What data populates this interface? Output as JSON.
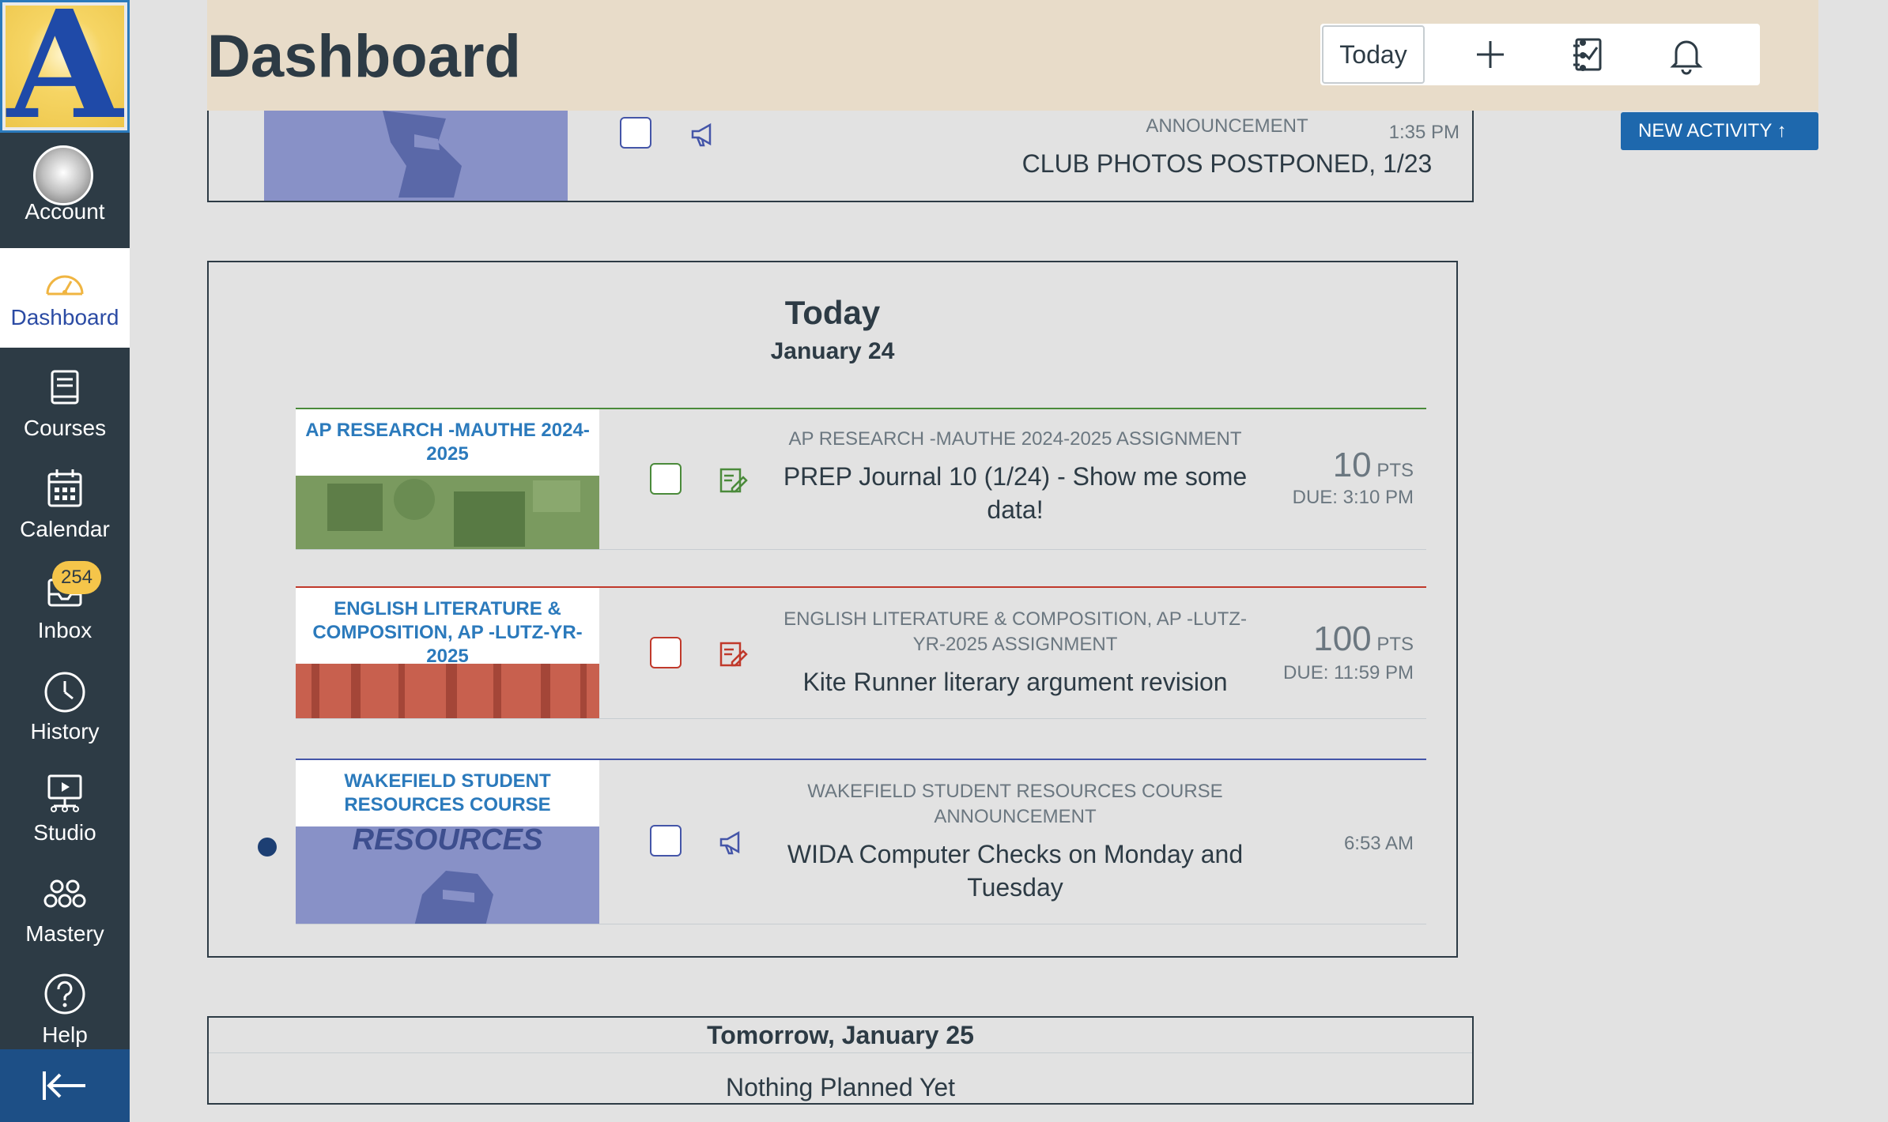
{
  "nav": {
    "items": [
      {
        "label": "Account",
        "icon": "avatar"
      },
      {
        "label": "Dashboard",
        "icon": "dashboard-icon"
      },
      {
        "label": "Courses",
        "icon": "courses-icon"
      },
      {
        "label": "Calendar",
        "icon": "calendar-icon"
      },
      {
        "label": "Inbox",
        "icon": "inbox-icon",
        "badge": "254"
      },
      {
        "label": "History",
        "icon": "history-icon"
      },
      {
        "label": "Studio",
        "icon": "studio-icon"
      },
      {
        "label": "Mastery",
        "icon": "mastery-icon"
      },
      {
        "label": "Help",
        "icon": "help-icon"
      }
    ],
    "logo_letter": "A"
  },
  "header": {
    "title": "Dashboard",
    "today_label": "Today",
    "new_activity_label": "NEW ACTIVITY ↑"
  },
  "top_item": {
    "type_label": "ANNOUNCEMENT",
    "title": "CLUB PHOTOS POSTPONED, 1/23",
    "time": "1:35 PM"
  },
  "today": {
    "heading": "Today",
    "date": "January 24",
    "items": [
      {
        "course": "AP RESEARCH -MAUTHE 2024-2025",
        "meta": "AP RESEARCH -MAUTHE 2024-2025 ASSIGNMENT",
        "title": "PREP Journal 10 (1/24) - Show me some data!",
        "points": "10",
        "points_unit": "PTS",
        "due": "DUE: 3:10 PM",
        "color": "#4a8a3a"
      },
      {
        "course": "ENGLISH LITERATURE & COMPOSITION, AP -LUTZ-YR-2025",
        "meta": "ENGLISH LITERATURE & COMPOSITION, AP -LUTZ-YR-2025 ASSIGNMENT",
        "title": "Kite Runner literary argument revision",
        "points": "100",
        "points_unit": "PTS",
        "due": "DUE: 11:59 PM",
        "color": "#c0392b"
      },
      {
        "course": "WAKEFIELD STUDENT RESOURCES COURSE",
        "meta": "WAKEFIELD STUDENT RESOURCES COURSE ANNOUNCEMENT",
        "title": "WIDA Computer Checks on Monday and Tuesday",
        "time": "6:53 AM",
        "image_text": "RESOURCES",
        "color": "#4455a8"
      }
    ]
  },
  "tomorrow": {
    "heading": "Tomorrow, January 25",
    "empty_text": "Nothing Planned Yet"
  }
}
